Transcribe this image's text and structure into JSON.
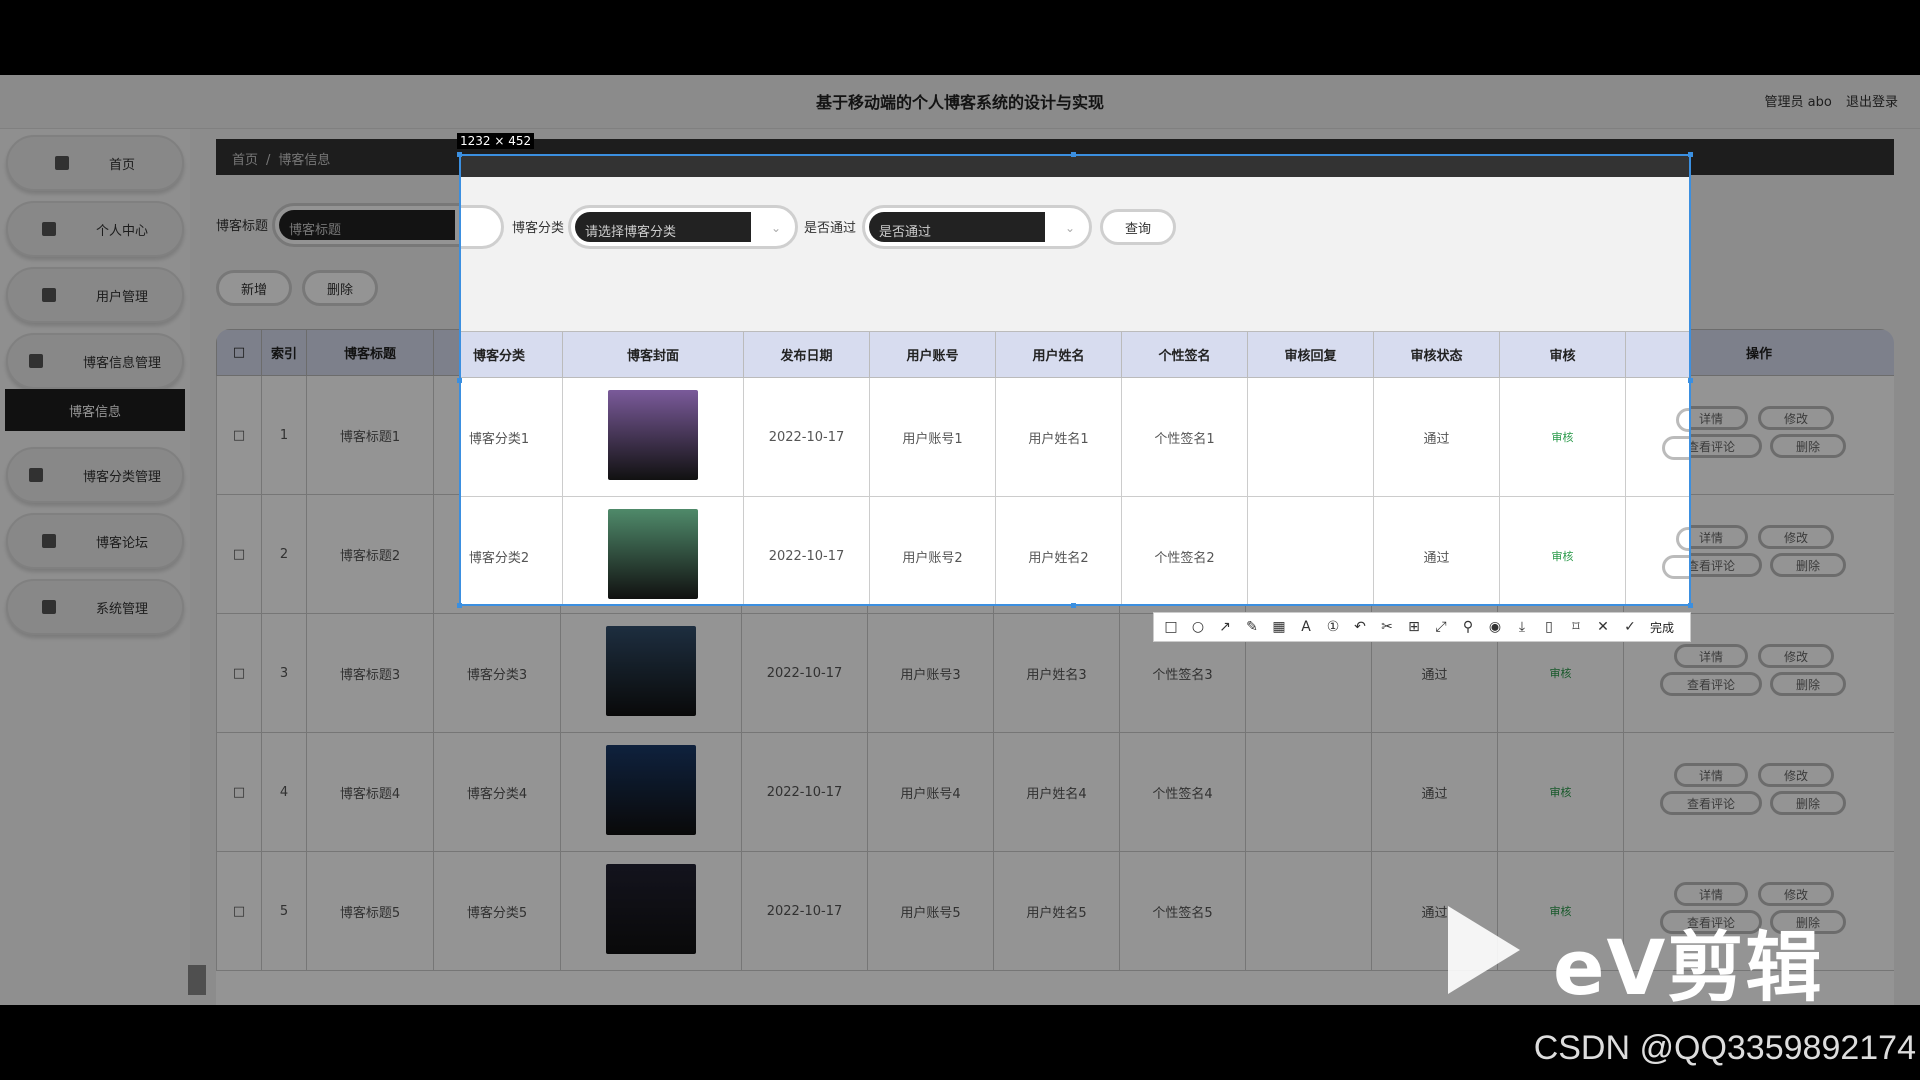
{
  "app": {
    "title": "基于移动端的个人博客系统的设计与实现",
    "user_label": "管理员 abo",
    "logout_label": "退出登录"
  },
  "sidebar": {
    "items": [
      {
        "label": "首页",
        "icon": "home-icon"
      },
      {
        "label": "个人中心",
        "icon": "user-icon"
      },
      {
        "label": "用户管理",
        "icon": "users-icon"
      },
      {
        "label": "博客信息管理",
        "icon": "list-icon"
      },
      {
        "label": "博客分类管理",
        "icon": "category-icon"
      },
      {
        "label": "博客论坛",
        "icon": "forum-icon"
      },
      {
        "label": "系统管理",
        "icon": "grid-icon"
      }
    ],
    "active_sub": "博客信息"
  },
  "breadcrumb": [
    "首页",
    "/",
    "博客信息"
  ],
  "search": {
    "title_label": "博客标题",
    "title_placeholder": "博客标题",
    "category_label": "博客分类",
    "category_placeholder": "请选择博客分类",
    "pass_label": "是否通过",
    "pass_placeholder": "是否通过",
    "query_button": "查询"
  },
  "actions": {
    "add": "新增",
    "delete": "删除"
  },
  "table": {
    "headers": [
      "索引",
      "博客标题",
      "博客分类",
      "博客封面",
      "发布日期",
      "用户账号",
      "用户姓名",
      "个性签名",
      "审核回复",
      "审核状态",
      "审核",
      "操作"
    ],
    "rows": [
      {
        "index": "1",
        "title": "博客标题1",
        "category": "博客分类1",
        "date": "2022-10-17",
        "account": "用户账号1",
        "name": "用户姓名1",
        "sign": "个性签名1",
        "reply": "",
        "status": "通过",
        "audit": "审核",
        "cover": "#7a5a9a"
      },
      {
        "index": "2",
        "title": "博客标题2",
        "category": "博客分类2",
        "date": "2022-10-17",
        "account": "用户账号2",
        "name": "用户姓名2",
        "sign": "个性签名2",
        "reply": "",
        "status": "通过",
        "audit": "审核",
        "cover": "#4f8a6a"
      },
      {
        "index": "3",
        "title": "博客标题3",
        "category": "博客分类3",
        "date": "2022-10-17",
        "account": "用户账号3",
        "name": "用户姓名3",
        "sign": "个性签名3",
        "reply": "",
        "status": "通过",
        "audit": "审核",
        "cover": "#33506e"
      },
      {
        "index": "4",
        "title": "博客标题4",
        "category": "博客分类4",
        "date": "2022-10-17",
        "account": "用户账号4",
        "name": "用户姓名4",
        "sign": "个性签名4",
        "reply": "",
        "status": "通过",
        "audit": "审核",
        "cover": "#1a3a6a"
      },
      {
        "index": "5",
        "title": "博客标题5",
        "category": "博客分类5",
        "date": "2022-10-17",
        "account": "用户账号5",
        "name": "用户姓名5",
        "sign": "个性签名5",
        "reply": "",
        "status": "通过",
        "audit": "审核",
        "cover": "#222233"
      }
    ],
    "row_ops": {
      "detail": "详情",
      "edit": "修改",
      "comments": "查看评论",
      "delete": "删除"
    }
  },
  "snip": {
    "size_text": "1232 × 452",
    "done_label": "完成",
    "tools": [
      "rect-icon",
      "ellipse-icon",
      "arrow-icon",
      "pen-icon",
      "mosaic-icon",
      "text-icon",
      "number-icon",
      "undo-icon",
      "cut-icon",
      "ocr-icon",
      "translate-icon",
      "pin-icon",
      "record-icon",
      "download-icon",
      "save-icon",
      "bookmark-icon",
      "close-icon"
    ]
  },
  "watermark": {
    "ev_text": "eV剪辑",
    "csdn_text": "CSDN @QQ3359892174"
  }
}
